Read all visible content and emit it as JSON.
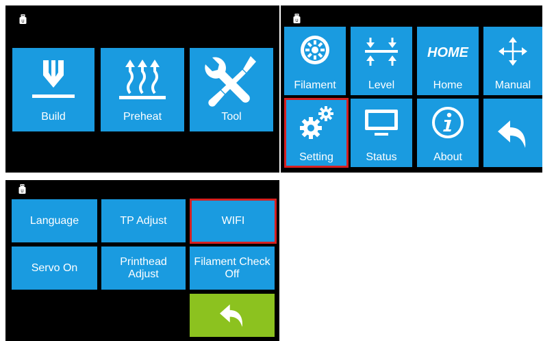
{
  "colors": {
    "tile_blue": "#1a9be0",
    "back_green": "#8cc21f",
    "selection_red": "#d62020",
    "panel_bg": "#000000"
  },
  "panel_main": {
    "status_icon": "usb-icon",
    "tiles": [
      {
        "label": "Build",
        "icon": "build-icon"
      },
      {
        "label": "Preheat",
        "icon": "heat-waves-icon"
      },
      {
        "label": "Tool",
        "icon": "wrench-screwdriver-icon"
      }
    ]
  },
  "panel_tool": {
    "status_icon": "usb-icon",
    "tiles": [
      {
        "label": "Filament",
        "icon": "filament-spool-icon"
      },
      {
        "label": "Level",
        "icon": "level-icon"
      },
      {
        "label": "Home",
        "icon_text": "HOME"
      },
      {
        "label": "Manual",
        "icon": "move-arrows-icon"
      },
      {
        "label": "Setting",
        "icon": "gears-icon",
        "selected": true
      },
      {
        "label": "Status",
        "icon": "monitor-icon"
      },
      {
        "label": "About",
        "icon": "info-icon"
      },
      {
        "label": "",
        "icon": "back-arrow-icon"
      }
    ]
  },
  "panel_setting": {
    "status_icon": "usb-icon",
    "buttons": [
      {
        "label": "Language"
      },
      {
        "label": "TP Adjust"
      },
      {
        "label": "WIFI",
        "selected": true
      },
      {
        "label": "Servo On"
      },
      {
        "label_line1": "Printhead",
        "label_line2": "Adjust"
      },
      {
        "label_line1": "Filament Check",
        "label_line2": "Off"
      }
    ],
    "back_icon": "back-arrow-icon"
  }
}
